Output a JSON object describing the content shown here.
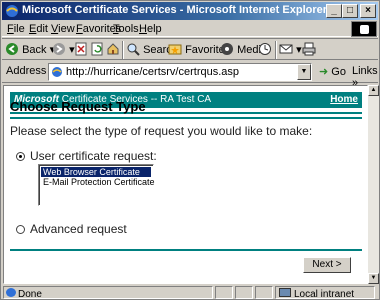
{
  "window": {
    "title": "Microsoft Certificate Services - Microsoft Internet Explorer",
    "minimize_glyph": "_",
    "maximize_glyph": "□",
    "close_glyph": "×"
  },
  "menu": [
    "File",
    "Edit",
    "View",
    "Favorites",
    "Tools",
    "Help"
  ],
  "toolbar": {
    "back_label": "Back",
    "search_label": "Search",
    "favorites_label": "Favorites",
    "media_label": "Media"
  },
  "address": {
    "label": "Address",
    "url": "http://hurricane/certsrv/certrqus.asp",
    "go_label": "Go",
    "links_label": "Links"
  },
  "page": {
    "banner_brand": "Microsoft",
    "banner_text": "Certificate Services  --  RA Test CA",
    "home_link": "Home",
    "heading": "Choose Request Type",
    "intro": "Please select the type of request you would like to make:",
    "user_request_label": "User certificate request:",
    "certificate_options": [
      "Web Browser Certificate",
      "E-Mail Protection Certificate"
    ],
    "selected_option": "Web Browser Certificate",
    "advanced_request_label": "Advanced request",
    "next_button": "Next >"
  },
  "status": {
    "left": "Done",
    "zone": "Local intranet"
  },
  "colors": {
    "title_bar": "#0a246a",
    "banner": "#008080",
    "selection": "#0a246a",
    "chrome": "#d4d0c8"
  }
}
